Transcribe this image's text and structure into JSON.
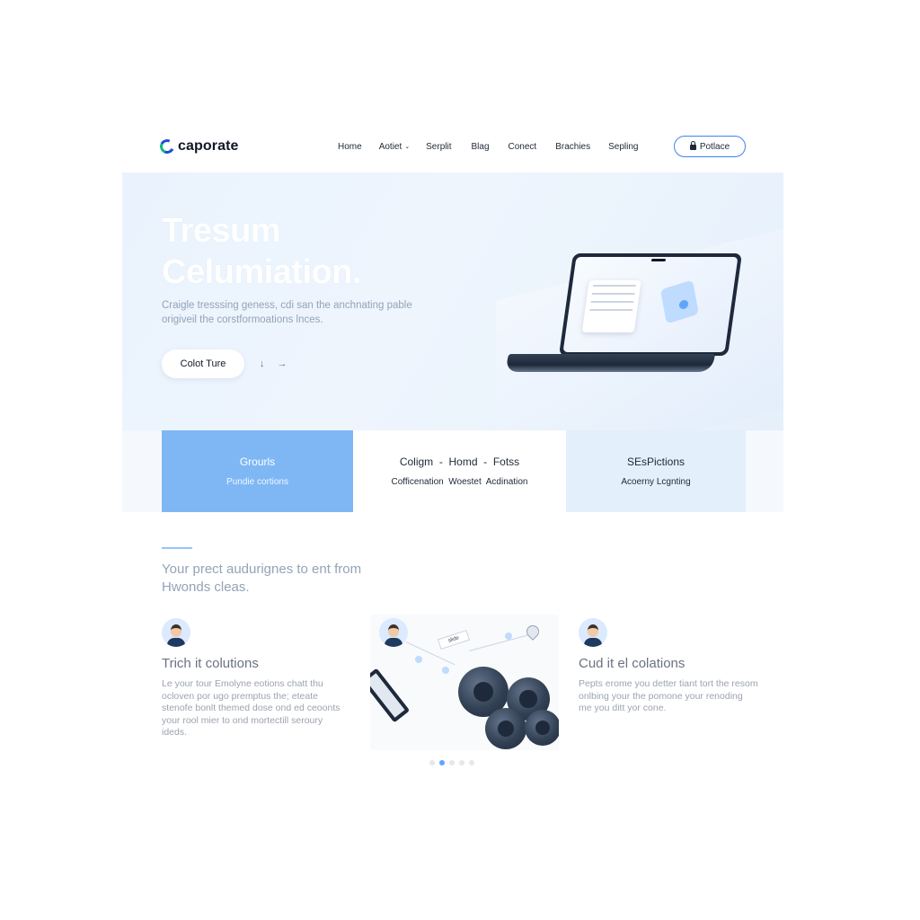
{
  "brand": {
    "name": "caporate",
    "colors": {
      "accent": "#3b82f6",
      "hero_bg": "#eaf3fd",
      "feature_active": "#7fb7f5",
      "text": "#1f2937",
      "muted": "#94a3b8"
    }
  },
  "nav": {
    "links": [
      {
        "label": "Home",
        "has_dropdown": false
      },
      {
        "label": "Aotiet",
        "has_dropdown": true
      },
      {
        "label": "Serplit",
        "has_dropdown": false
      },
      {
        "label": "Blag",
        "has_dropdown": false
      },
      {
        "label": "Conect",
        "has_dropdown": false
      },
      {
        "label": "Brachies",
        "has_dropdown": false
      },
      {
        "label": "Sepling",
        "has_dropdown": false
      }
    ],
    "cta_label": "Potlace",
    "cta_icon": "lock-icon"
  },
  "hero": {
    "title_line1": "Tresum",
    "title_line2": "Celumiation.",
    "subtitle": "Craigle tresssing geness, cdi san the anchnating pable origiveil the corstformoations lnces.",
    "button_label": "Colot Ture",
    "icon_1": "↓",
    "icon_2": "→"
  },
  "features": [
    {
      "title": "Grourls",
      "desc": "Pundie cortions",
      "active": true
    },
    {
      "title": "Coligm  -  Homd  -  Fotss",
      "desc": "Cofficenation  Woestet  Acdination",
      "active": false
    },
    {
      "title": "SEsPictions",
      "desc": "Acoerny Lcgnting",
      "active": false
    }
  ],
  "section": {
    "title": "Your prect audurignes to ent from Hwonds cleas.",
    "cards": [
      {
        "title": "Trich it colutions",
        "text": "Le your tour Emolyne eotions chatt thu ocloven por ugo premptus the; eteate stenofe bonlt themed dose ond ed ceoonts your rool mier to ond mortectill seroury ideds."
      },
      {
        "title": "Cud it el colations",
        "text": "Pepts erome you detter tiant tort the resom onlbing your the pomone your renoding me you ditt yor cone."
      }
    ],
    "visual_tag": "slide",
    "carousel": {
      "count": 5,
      "active_index": 1
    }
  }
}
